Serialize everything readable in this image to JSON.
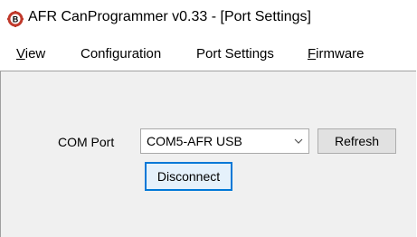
{
  "window": {
    "title": "AFR CanProgrammer v0.33 - [Port Settings]",
    "icon": "afr-logo-icon"
  },
  "menu": {
    "items": [
      {
        "label_mnemonic": "V",
        "label_rest": "iew"
      },
      {
        "label": "Configuration"
      },
      {
        "label": "Port Settings"
      },
      {
        "label_mnemonic": "F",
        "label_rest": "irmware"
      }
    ]
  },
  "port_settings": {
    "com_label": "COM Port",
    "com_selected": "COM5-AFR USB",
    "refresh_label": "Refresh",
    "disconnect_label": "Disconnect"
  },
  "colors": {
    "client_bg": "#f0f0f0",
    "focus_border": "#0078d7",
    "logo_red": "#c0392b"
  }
}
